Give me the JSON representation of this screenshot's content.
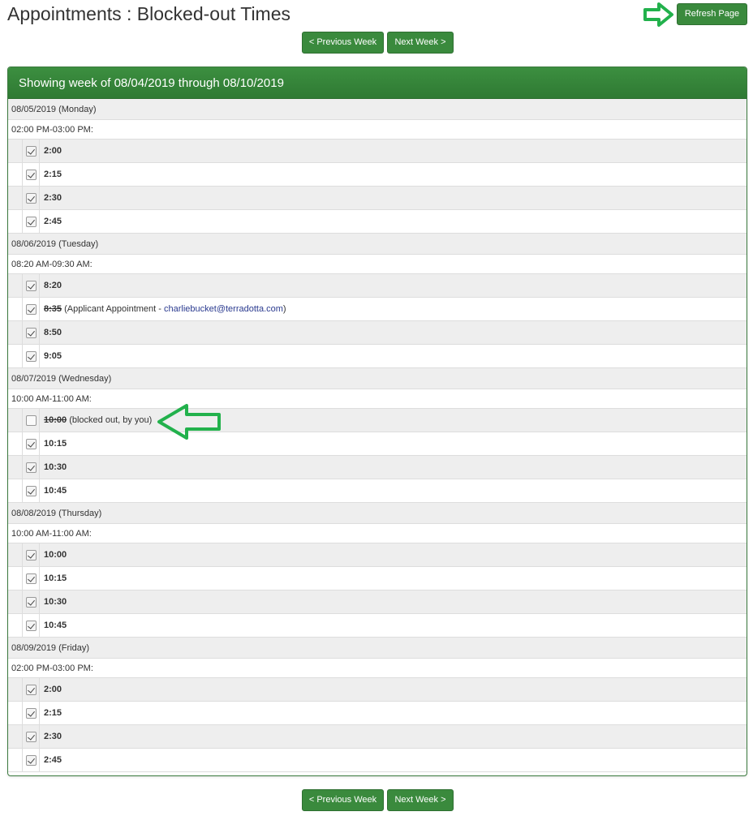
{
  "page": {
    "title": "Appointments : Blocked-out Times",
    "refresh_label": "Refresh Page",
    "prev_week_label": "< Previous Week",
    "next_week_label": "Next Week >"
  },
  "panel": {
    "header": "Showing week of 08/04/2019 through 08/10/2019"
  },
  "colors": {
    "primary_green": "#3a8a3d",
    "annotation_arrow": "#22b14c",
    "link": "#2a3a8f"
  },
  "days": [
    {
      "date_label": "08/05/2019 (Monday)",
      "range_label": "02:00 PM-03:00 PM:",
      "slots": [
        {
          "time": "2:00",
          "checked": true
        },
        {
          "time": "2:15",
          "checked": true
        },
        {
          "time": "2:30",
          "checked": true
        },
        {
          "time": "2:45",
          "checked": true
        }
      ]
    },
    {
      "date_label": "08/06/2019 (Tuesday)",
      "range_label": "08:20 AM-09:30 AM:",
      "slots": [
        {
          "time": "8:20",
          "checked": true
        },
        {
          "time": "8:35",
          "checked": true,
          "struck": true,
          "note_prefix": " (Applicant Appointment - ",
          "link": "charliebucket@terradotta.com",
          "note_suffix": ")"
        },
        {
          "time": "8:50",
          "checked": true
        },
        {
          "time": "9:05",
          "checked": true
        }
      ]
    },
    {
      "date_label": "08/07/2019 (Wednesday)",
      "range_label": "10:00 AM-11:00 AM:",
      "slots": [
        {
          "time": "10:00",
          "checked": false,
          "struck": true,
          "note_prefix": " (blocked out, by you)"
        },
        {
          "time": "10:15",
          "checked": true
        },
        {
          "time": "10:30",
          "checked": true
        },
        {
          "time": "10:45",
          "checked": true
        }
      ]
    },
    {
      "date_label": "08/08/2019 (Thursday)",
      "range_label": "10:00 AM-11:00 AM:",
      "slots": [
        {
          "time": "10:00",
          "checked": true
        },
        {
          "time": "10:15",
          "checked": true
        },
        {
          "time": "10:30",
          "checked": true
        },
        {
          "time": "10:45",
          "checked": true
        }
      ]
    },
    {
      "date_label": "08/09/2019 (Friday)",
      "range_label": "02:00 PM-03:00 PM:",
      "slots": [
        {
          "time": "2:00",
          "checked": true
        },
        {
          "time": "2:15",
          "checked": true
        },
        {
          "time": "2:30",
          "checked": true
        },
        {
          "time": "2:45",
          "checked": true
        }
      ]
    }
  ]
}
